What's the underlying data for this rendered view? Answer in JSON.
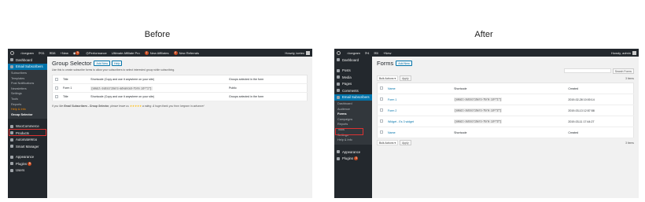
{
  "labels": {
    "before": "Before",
    "after": "After"
  },
  "before": {
    "adminbar": {
      "site": "Icegram",
      "updates": "31",
      "comments": "38",
      "new": "New",
      "badge": "9",
      "performance": "Performance",
      "affiliate_pro": "Ultimate Affiliate Pro",
      "affiliates_count": "1",
      "affiliates": "New Affiliates",
      "referrals_count": "0",
      "referrals": "New Referrals",
      "howdy": "Howdy, icetec"
    },
    "sidebar": {
      "dashboard": "Dashboard",
      "email_subscribers": "Email Subscribers",
      "submenu": [
        "Subscribers",
        "Templates",
        "Post Notifications",
        "Newsletters",
        "Settings",
        "Tools",
        "Reports",
        "Help & Info",
        "Group Selector"
      ],
      "woocommerce": "WooCommerce",
      "products": "Products",
      "automatewoo": "AutomateWoo",
      "smart_manager": "Smart Manager",
      "appearance": "Appearance",
      "plugins": "Plugins",
      "plugins_badge": "8",
      "users": "Users"
    },
    "page": {
      "title": "Group Selector",
      "add_new": "Add New",
      "help": "Help",
      "note": "Use this to create subscribe forms to allow your subscribers to select interested group while subscribing.",
      "columns": [
        "Title",
        "Shortcode (Copy and use it anywhere on your site)",
        "Groups selected in the form"
      ],
      "rows": [
        {
          "title": "Form 1",
          "shortcode": "[email-subscribers-advanced-form id=\"1\"]",
          "groups": "Public"
        }
      ],
      "footer_note_pre": "If you like ",
      "footer_note_strong": "Email Subscribers - Group Selector",
      "footer_note_mid": ", please leave us ",
      "footer_stars": "★★★★★",
      "footer_note_post": " a rating. A huge thank you from Icegram in advance!"
    }
  },
  "after": {
    "adminbar": {
      "site": "Icegram",
      "updates": "4",
      "comments": "0",
      "new": "New",
      "howdy": "Howdy, admin"
    },
    "sidebar": {
      "dashboard": "Dashboard",
      "posts": "Posts",
      "media": "Media",
      "pages": "Pages",
      "comments": "Comments",
      "email_subscribers": "Email Subscribers",
      "submenu": [
        "Dashboard",
        "Audience",
        "Forms",
        "Campaigns",
        "Reports",
        "Tools",
        "Settings",
        "Help & Info"
      ],
      "appearance": "Appearance",
      "plugins": "Plugins",
      "plugins_badge": "4"
    },
    "page": {
      "title": "Forms",
      "add_new": "Add New",
      "search_button": "Search Forms",
      "bulk_actions": "Bulk Actions ▾",
      "apply": "Apply",
      "items": "3 items",
      "columns": [
        "Name",
        "Shortcode",
        "Created"
      ],
      "rows": [
        {
          "name": "Form 1",
          "shortcode": "[email-subscribers-form id=\"1\"]",
          "created": "2019-02-28 10:00:14"
        },
        {
          "name": "Form 2",
          "shortcode": "[email-subscribers-form id=\"2\"]",
          "created": "2019-03-13 12:57:58"
        },
        {
          "name": "Widget - Es 3 widget",
          "shortcode": "[email-subscribers-form id=\"3\"]",
          "created": "2019-03-11 17:44:27"
        }
      ]
    }
  },
  "colors": {
    "highlight_red": "#dc3232",
    "menu_blue": "#0073aa",
    "sidebar_dark": "#23282d"
  }
}
